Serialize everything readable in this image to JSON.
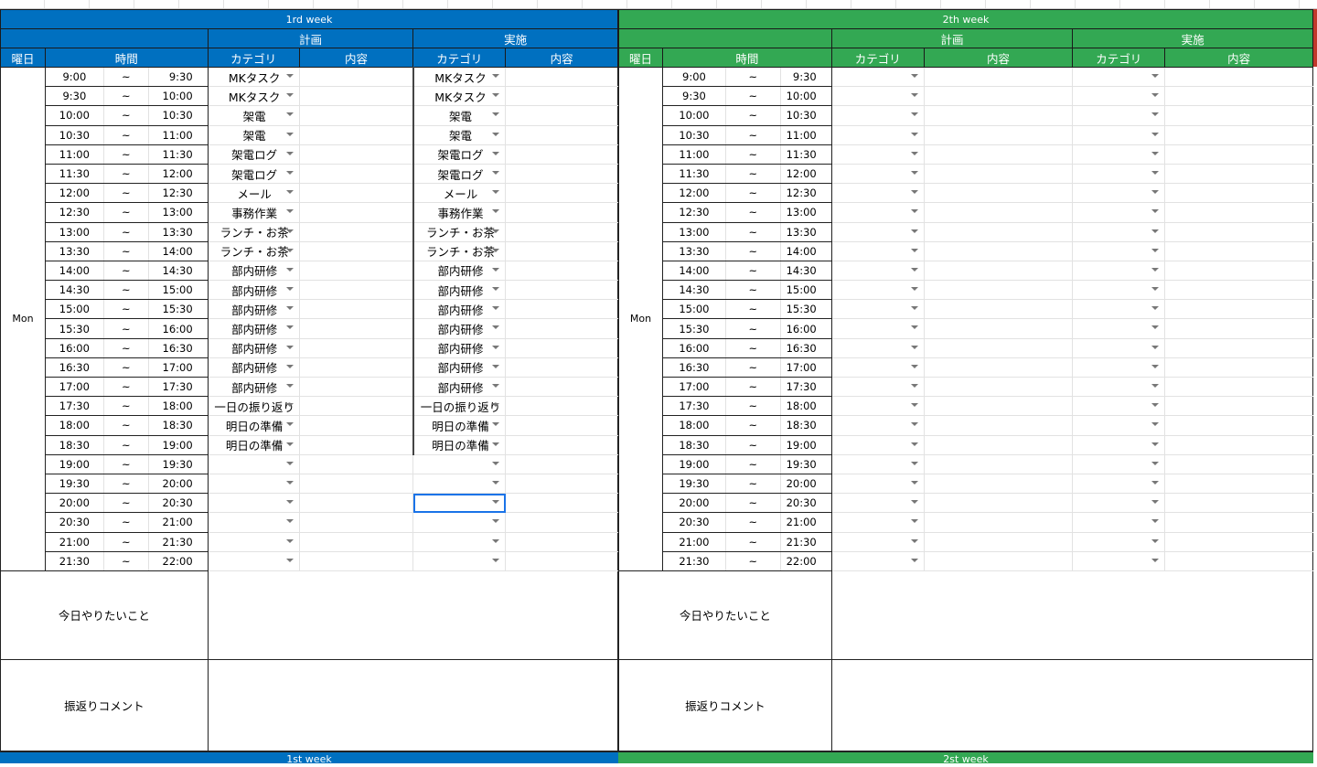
{
  "weeks": [
    {
      "title": "1rd week",
      "theme": "blue",
      "color": "#0070c0",
      "plan_label": "計画",
      "actual_label": "実施",
      "day_header": "曜日",
      "time_header": "時間",
      "cat_header": "カテゴリ",
      "content_header": "内容",
      "day": "Mon",
      "today_label": "今日やりたいこと",
      "comment_label": "振返りコメント",
      "selected_row": 22,
      "plan": [
        "MKタスク",
        "MKタスク",
        "架電",
        "架電",
        "架電ログ",
        "架電ログ",
        "メール",
        "事務作業",
        "ランチ・お茶",
        "ランチ・お茶",
        "部内研修",
        "部内研修",
        "部内研修",
        "部内研修",
        "部内研修",
        "部内研修",
        "部内研修",
        "一日の振り返り",
        "明日の準備",
        "明日の準備",
        "",
        "",
        "",
        "",
        "",
        ""
      ],
      "actual": [
        "MKタスク",
        "MKタスク",
        "架電",
        "架電",
        "架電ログ",
        "架電ログ",
        "メール",
        "事務作業",
        "ランチ・お茶",
        "ランチ・お茶",
        "部内研修",
        "部内研修",
        "部内研修",
        "部内研修",
        "部内研修",
        "部内研修",
        "部内研修",
        "一日の振り返り",
        "明日の準備",
        "明日の準備",
        "",
        "",
        "",
        "",
        "",
        ""
      ]
    },
    {
      "title": "2th week",
      "theme": "green",
      "color": "#33a853",
      "plan_label": "計画",
      "actual_label": "実施",
      "day_header": "曜日",
      "time_header": "時間",
      "cat_header": "カテゴリ",
      "content_header": "内容",
      "day": "Mon",
      "today_label": "今日やりたいこと",
      "comment_label": "振返りコメント",
      "selected_row": -1,
      "plan": [
        "",
        "",
        "",
        "",
        "",
        "",
        "",
        "",
        "",
        "",
        "",
        "",
        "",
        "",
        "",
        "",
        "",
        "",
        "",
        "",
        "",
        "",
        "",
        "",
        "",
        ""
      ],
      "actual": [
        "",
        "",
        "",
        "",
        "",
        "",
        "",
        "",
        "",
        "",
        "",
        "",
        "",
        "",
        "",
        "",
        "",
        "",
        "",
        "",
        "",
        "",
        "",
        "",
        "",
        ""
      ]
    }
  ],
  "time_slots": [
    [
      "9:00",
      "9:30"
    ],
    [
      "9:30",
      "10:00"
    ],
    [
      "10:00",
      "10:30"
    ],
    [
      "10:30",
      "11:00"
    ],
    [
      "11:00",
      "11:30"
    ],
    [
      "11:30",
      "12:00"
    ],
    [
      "12:00",
      "12:30"
    ],
    [
      "12:30",
      "13:00"
    ],
    [
      "13:00",
      "13:30"
    ],
    [
      "13:30",
      "14:00"
    ],
    [
      "14:00",
      "14:30"
    ],
    [
      "14:30",
      "15:00"
    ],
    [
      "15:00",
      "15:30"
    ],
    [
      "15:30",
      "16:00"
    ],
    [
      "16:00",
      "16:30"
    ],
    [
      "16:30",
      "17:00"
    ],
    [
      "17:00",
      "17:30"
    ],
    [
      "17:30",
      "18:00"
    ],
    [
      "18:00",
      "18:30"
    ],
    [
      "18:30",
      "19:00"
    ],
    [
      "19:00",
      "19:30"
    ],
    [
      "19:30",
      "20:00"
    ],
    [
      "20:00",
      "20:30"
    ],
    [
      "20:30",
      "21:00"
    ],
    [
      "21:00",
      "21:30"
    ],
    [
      "21:30",
      "22:00"
    ]
  ],
  "tilde": "~",
  "next_weeks": [
    "1st week",
    "2st week"
  ]
}
